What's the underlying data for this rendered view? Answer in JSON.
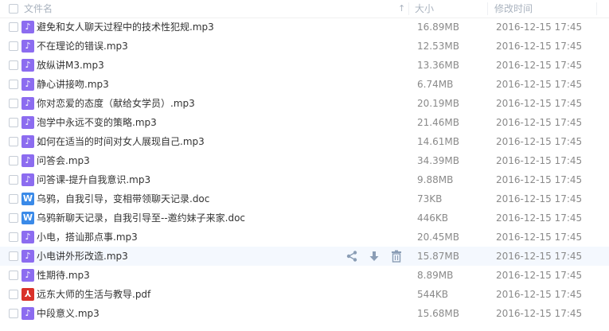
{
  "header": {
    "name_label": "文件名",
    "size_label": "大小",
    "time_label": "修改时间"
  },
  "files": [
    {
      "name": "避免和女人聊天过程中的技术性犯规.mp3",
      "type": "mp3",
      "size": "16.89MB",
      "time": "2016-12-15 17:45"
    },
    {
      "name": "不在理论的错误.mp3",
      "type": "mp3",
      "size": "12.53MB",
      "time": "2016-12-15 17:45"
    },
    {
      "name": "放纵讲M3.mp3",
      "type": "mp3",
      "size": "13.36MB",
      "time": "2016-12-15 17:45"
    },
    {
      "name": "静心讲接吻.mp3",
      "type": "mp3",
      "size": "6.74MB",
      "time": "2016-12-15 17:45"
    },
    {
      "name": "你对恋爱的态度（献给女学员）.mp3",
      "type": "mp3",
      "size": "20.19MB",
      "time": "2016-12-15 17:45"
    },
    {
      "name": "泡学中永远不变的策略.mp3",
      "type": "mp3",
      "size": "21.46MB",
      "time": "2016-12-15 17:45"
    },
    {
      "name": "如何在适当的时间对女人展现自己.mp3",
      "type": "mp3",
      "size": "14.61MB",
      "time": "2016-12-15 17:45"
    },
    {
      "name": "问答会.mp3",
      "type": "mp3",
      "size": "34.39MB",
      "time": "2016-12-15 17:45"
    },
    {
      "name": "问答课-提升自我意识.mp3",
      "type": "mp3",
      "size": "9.88MB",
      "time": "2016-12-15 17:45"
    },
    {
      "name": "乌鸦，自我引导，变相带领聊天记录.doc",
      "type": "doc",
      "size": "73KB",
      "time": "2016-12-15 17:45"
    },
    {
      "name": "乌鸦新聊天记录，自我引导至--邀约妹子来家.doc",
      "type": "doc",
      "size": "446KB",
      "time": "2016-12-15 17:45"
    },
    {
      "name": "小电，搭讪那点事.mp3",
      "type": "mp3",
      "size": "20.45MB",
      "time": "2016-12-15 17:45"
    },
    {
      "name": "小电讲外形改造.mp3",
      "type": "mp3",
      "size": "15.87MB",
      "time": "2016-12-15 17:45"
    },
    {
      "name": "性期待.mp3",
      "type": "mp3",
      "size": "8.89MB",
      "time": "2016-12-15 17:45"
    },
    {
      "name": "远东大师的生活与教导.pdf",
      "type": "pdf",
      "size": "544KB",
      "time": "2016-12-15 17:45"
    },
    {
      "name": "中段意义.mp3",
      "type": "mp3",
      "size": "15.68MB",
      "time": "2016-12-15 17:45"
    }
  ],
  "icons": {
    "mp3": "music-note-icon",
    "doc": "word-doc-icon",
    "pdf": "pdf-icon",
    "row_actions": [
      "share-icon",
      "download-icon",
      "delete-icon"
    ],
    "sort": "sort-arrow-icon"
  },
  "colors": {
    "mp3": "#8c6cf0",
    "doc": "#3a8ae8",
    "pdf": "#d9312a",
    "hover_row": "#f4f8fe",
    "action_icon": "#8a9db5"
  },
  "hovered_row_index": 12
}
